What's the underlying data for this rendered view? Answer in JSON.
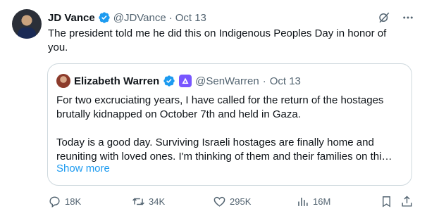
{
  "tweet": {
    "author_name": "JD Vance",
    "handle": "@JDVance",
    "separator": "·",
    "date": "Oct 13",
    "text_line1": "The president told me he did this on Indigenous Peoples Day in honor of",
    "text_line2": "you."
  },
  "quote": {
    "author_name": "Elizabeth Warren",
    "handle": "@SenWarren",
    "separator": "·",
    "date": "Oct 13",
    "lines": [
      "For two excruciating years, I have called for the return of the hostages",
      "brutally kidnapped on October 7th and held in Gaza.",
      "Today is a good day. Surviving Israeli hostages are finally home and",
      "reuniting with loved ones. I'm thinking of them and their families on thi…"
    ],
    "show_more": "Show more"
  },
  "actions": {
    "replies": "18K",
    "reposts": "34K",
    "likes": "295K",
    "views": "16M"
  },
  "icons": {
    "verified": "verified-badge-icon",
    "grok": "grok-icon",
    "more": "more-icon",
    "government_badge": "government-badge-icon",
    "reply": "reply-icon",
    "repost": "repost-icon",
    "like": "like-icon",
    "views": "views-icon",
    "bookmark": "bookmark-icon",
    "share": "share-icon"
  },
  "colors": {
    "verified": "#1d9bf0",
    "link": "#1d9bf0",
    "muted": "#536471",
    "border": "#cfd9de",
    "badge": "#7856ff"
  }
}
